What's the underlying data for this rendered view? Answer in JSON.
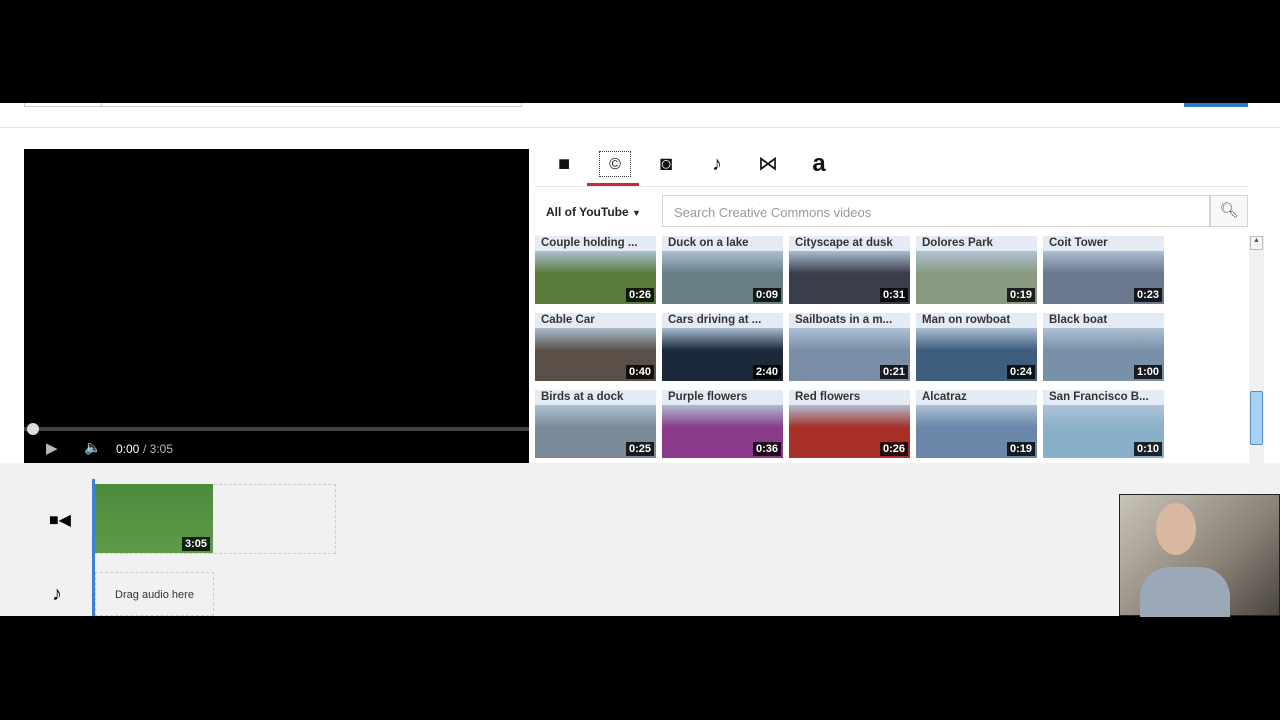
{
  "player": {
    "time_current": "0:00",
    "time_total": "/ 3:05"
  },
  "tabs": [
    {
      "icon": "video-camera-icon",
      "glyph": "■"
    },
    {
      "icon": "creative-commons-icon",
      "glyph": "©"
    },
    {
      "icon": "camera-icon",
      "glyph": "◙"
    },
    {
      "icon": "music-note-icon",
      "glyph": "♪"
    },
    {
      "icon": "transition-bowtie-icon",
      "glyph": "⋈"
    },
    {
      "icon": "text-icon",
      "glyph": "a"
    }
  ],
  "active_tab": "creative-commons",
  "accent_color": "#cc2b2b",
  "search": {
    "scope": "All of YouTube",
    "placeholder": "Search Creative Commons videos"
  },
  "videos": [
    {
      "title": "Couple holding ...",
      "duration": "0:26",
      "color": "#5a7a3a"
    },
    {
      "title": "Duck on a lake",
      "duration": "0:09",
      "color": "#6a7e86"
    },
    {
      "title": "Cityscape at dusk",
      "duration": "0:31",
      "color": "#3a3e4a"
    },
    {
      "title": "Dolores Park",
      "duration": "0:19",
      "color": "#8a9a80"
    },
    {
      "title": "Coit Tower",
      "duration": "0:23",
      "color": "#6a7890"
    },
    {
      "title": "Cable Car",
      "duration": "0:40",
      "color": "#5a5048"
    },
    {
      "title": "Cars driving at ...",
      "duration": "2:40",
      "color": "#1a2a3a"
    },
    {
      "title": "Sailboats in a m...",
      "duration": "0:21",
      "color": "#7a8ea8"
    },
    {
      "title": "Man on rowboat",
      "duration": "0:24",
      "color": "#3e5e7e"
    },
    {
      "title": "Black boat",
      "duration": "1:00",
      "color": "#7890a8"
    },
    {
      "title": "Birds at a dock",
      "duration": "0:25",
      "color": "#7a8a98"
    },
    {
      "title": "Purple flowers",
      "duration": "0:36",
      "color": "#8a3a8a"
    },
    {
      "title": "Red flowers",
      "duration": "0:26",
      "color": "#a83028"
    },
    {
      "title": "Alcatraz",
      "duration": "0:19",
      "color": "#6a86a8"
    },
    {
      "title": "San Francisco B...",
      "duration": "0:10",
      "color": "#88b0c8"
    }
  ],
  "timeline": {
    "clip_duration": "3:05",
    "audio_placeholder": "Drag audio here"
  }
}
